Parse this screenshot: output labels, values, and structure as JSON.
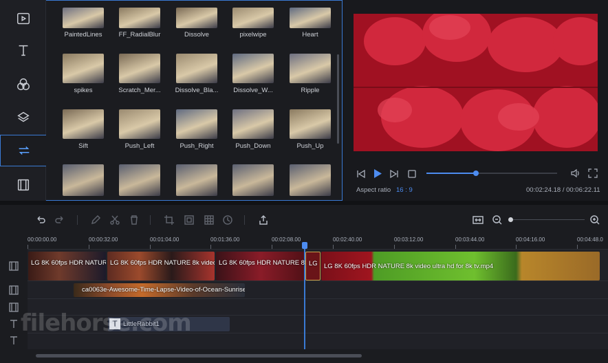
{
  "colors": {
    "accent": "#3a7bd5",
    "panel": "#1b1c20",
    "video_bg": "#c2162c"
  },
  "sidebar": {
    "items": [
      {
        "icon": "media-icon"
      },
      {
        "icon": "text-icon"
      },
      {
        "icon": "filters-icon"
      },
      {
        "icon": "overlays-icon"
      },
      {
        "icon": "transitions-icon",
        "active": true
      },
      {
        "icon": "elements-icon"
      }
    ]
  },
  "library": {
    "rows": [
      [
        "PaintedLines",
        "FF_RadialBlur",
        "Dissolve",
        "pixelwipe",
        "Heart"
      ],
      [
        "spikes",
        "Scratch_Mer...",
        "Dissolve_Bla...",
        "Dissolve_W...",
        "Ripple"
      ],
      [
        "Sift",
        "Push_Left",
        "Push_Right",
        "Push_Down",
        "Push_Up"
      ]
    ]
  },
  "preview": {
    "aspect_label": "Aspect ratio",
    "aspect_value": "16 : 9",
    "time": "00:02:24.18 / 00:06:22.11",
    "progress": 0.38
  },
  "ruler": {
    "ticks": [
      "00:00:00.00",
      "00:00:32.00",
      "00:01:04.00",
      "00:01:36.00",
      "00:02:08.00",
      "00:02:40.00",
      "00:03:12.00",
      "00:03:44.00",
      "00:04:16.00",
      "00:04:48.0"
    ]
  },
  "timeline": {
    "video_clips": [
      "LG 8K 60fps HDR NATURE",
      "LG 8K 60fps HDR NATURE 8k video",
      "LG 8K 60fps HDR NATURE 8k",
      "LG",
      "LG 8K 60fps HDR NATURE 8k video ultra hd for 8k tv.mp4"
    ],
    "overlay_clip": "ca0063e-Awesome-Time-Lapse-Video-of-Ocean-Sunrise",
    "text_clip": "LittleRabbit1"
  },
  "watermark": "filehorse.com"
}
